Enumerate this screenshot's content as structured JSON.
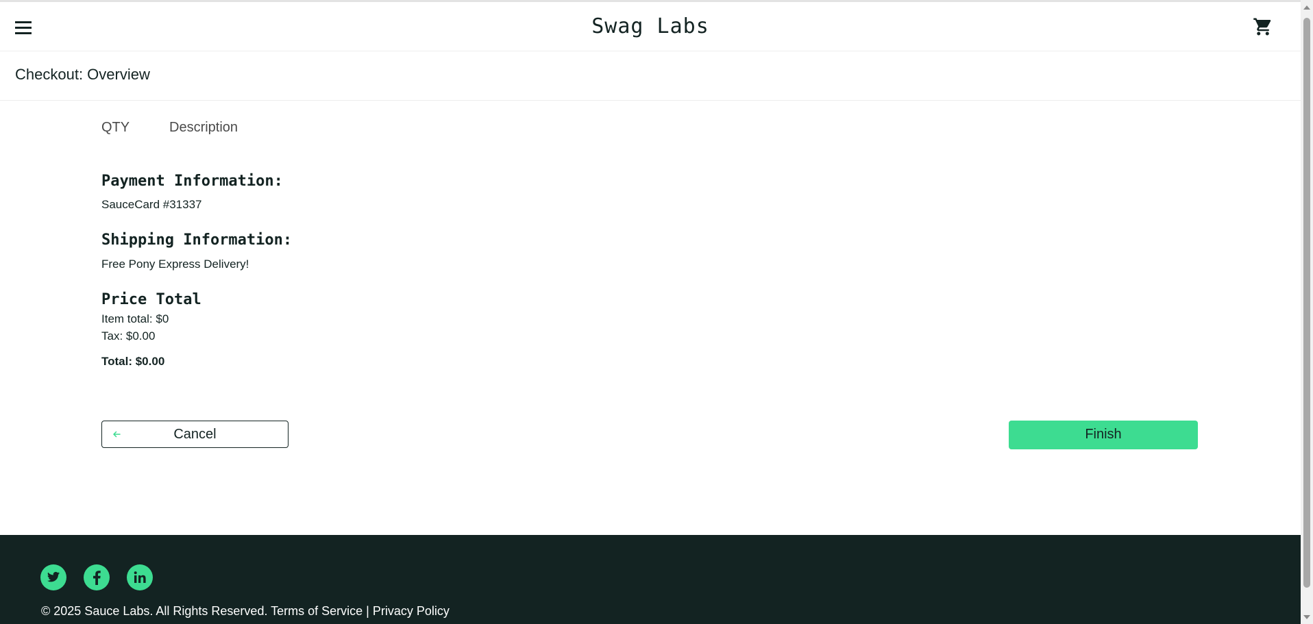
{
  "header": {
    "menu_icon": "hamburger-menu-icon",
    "app_logo": "Swag Labs",
    "cart_icon": "shopping-cart-icon"
  },
  "secondary_header": {
    "title": "Checkout: Overview"
  },
  "cart_list": {
    "columns": [
      "QTY",
      "Description"
    ]
  },
  "summary": {
    "payment_label": "Payment Information:",
    "payment_value": "SauceCard #31337",
    "shipping_label": "Shipping Information:",
    "shipping_value": "Free Pony Express Delivery!",
    "price_label": "Price Total",
    "item_total": "Item total: $0",
    "tax": "Tax: $0.00",
    "total": "Total: $0.00"
  },
  "actions": {
    "cancel_label": "Cancel",
    "cancel_icon": "arrow-left-icon",
    "finish_label": "Finish"
  },
  "footer": {
    "social": [
      "twitter-icon",
      "facebook-icon",
      "linkedin-icon"
    ],
    "copyright": "© 2025 Sauce Labs. All Rights Reserved. Terms of Service | Privacy Policy"
  },
  "colors": {
    "accent": "#3ddc91",
    "dark": "#132322",
    "background": "#ffffff"
  }
}
